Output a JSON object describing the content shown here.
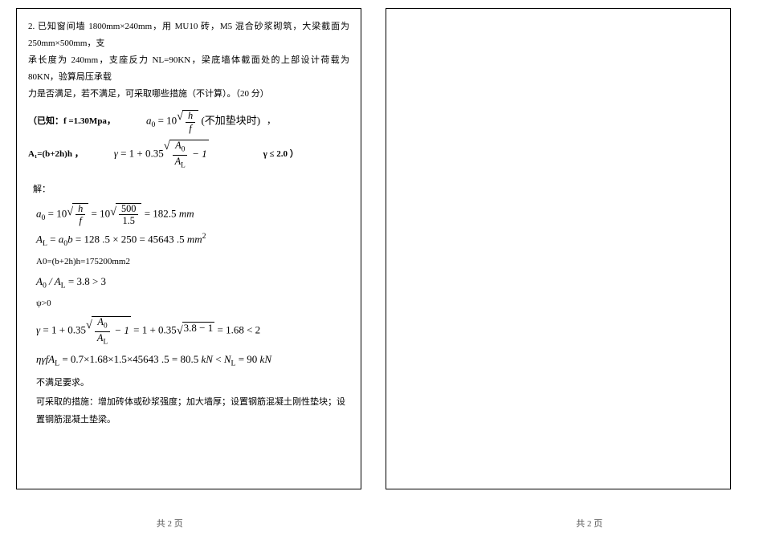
{
  "problem": {
    "number": "2.",
    "line1": "已知窗间墙 1800mm×240mm，用 MU10 砖，M5 混合砂浆砌筑，大梁截面为 250mm×500mm，支",
    "line2": "承长度为 240mm，支座反力 NL=90KN，梁底墙体截面处的上部设计荷载为 80KN，验算局压承载",
    "line3": "力是否满足，若不满足，可采取哪些措施（不计算）。（20 分）"
  },
  "given": {
    "known_label": "（已知：f =1.30Mpa，",
    "a0_formula": "a₀ = 10√(h/f) (不加垫块时)",
    "a0_tail": "，",
    "a1_label": "A₁=(b+2h)h ，",
    "gamma_formula": "γ = 1 + 0.35√(A₀/A_L − 1)",
    "gamma_tail": "γ ≤ 2.0 ）"
  },
  "solution": {
    "label": "解：",
    "steps": {
      "a0": "a₀ = 10√(h/f) = 10√(500/1.5) = 182.5 mm",
      "Al": "A_L = a₀·b = 128.5 × 250 = 45643.5 mm²",
      "A0": "A0=(b+2h)h=175200mm2",
      "ratio": "A₀ / A_L = 3.8 > 3",
      "psi": "ψ>0",
      "gamma": "γ = 1 + 0.35√(A₀/A_L − 1) = 1 + 0.35√(3.8−1) = 1.68 < 2",
      "check": "ηγfA_L = 0.7×1.68×1.5×45643.5 = 80.5 kN < N_L = 90 kN",
      "result": "不满足要求。",
      "measures": "可采取的措施：增加砖体或砂浆强度；加大墙厚；设置钢筋混凝土刚性垫块；设置钢筋混凝土垫梁。"
    }
  },
  "footer": {
    "text": "共 2 页"
  }
}
